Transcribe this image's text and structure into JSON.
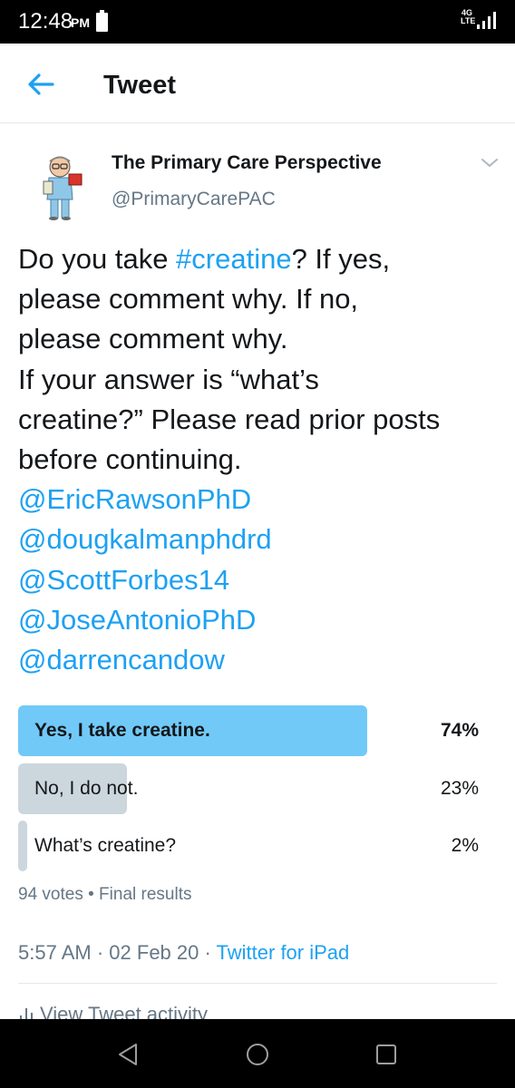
{
  "status_bar": {
    "time": "12:48",
    "ampm": "PM",
    "network_top": "4G",
    "network_bottom": "LTE"
  },
  "header": {
    "back_icon": "arrow-left-icon",
    "title": "Tweet"
  },
  "author": {
    "name": "The Primary Care Perspective",
    "handle": "@PrimaryCarePAC",
    "menu_icon": "chevron-down-icon"
  },
  "tweet": {
    "lines": [
      {
        "segments": [
          {
            "text": "Do you take ",
            "link": false
          },
          {
            "text": "#creatine",
            "link": true
          },
          {
            "text": "? If yes,",
            "link": false
          }
        ]
      },
      {
        "segments": [
          {
            "text": "please comment why.  If no,",
            "link": false
          }
        ]
      },
      {
        "segments": [
          {
            "text": "please comment why.",
            "link": false
          }
        ]
      },
      {
        "segments": [
          {
            "text": "If your answer is “what’s",
            "link": false
          }
        ]
      },
      {
        "segments": [
          {
            "text": "creatine?” Please read prior posts",
            "link": false
          }
        ]
      },
      {
        "segments": [
          {
            "text": "before continuing.",
            "link": false
          }
        ]
      },
      {
        "segments": [
          {
            "text": "@EricRawsonPhD",
            "link": true
          }
        ]
      },
      {
        "segments": [
          {
            "text": "@dougkalmanphdrd",
            "link": true
          }
        ]
      },
      {
        "segments": [
          {
            "text": "@ScottForbes14",
            "link": true
          }
        ]
      },
      {
        "segments": [
          {
            "text": "@JoseAntonioPhD",
            "link": true
          }
        ]
      },
      {
        "segments": [
          {
            "text": "@darrencandow",
            "link": true
          }
        ]
      }
    ]
  },
  "poll": {
    "options": [
      {
        "label": "Yes, I take creatine.",
        "percent_label": "74%",
        "fraction": 0.74,
        "winner": true
      },
      {
        "label": "No, I do not.",
        "percent_label": "23%",
        "fraction": 0.23,
        "winner": false
      },
      {
        "label": "What’s creatine?",
        "percent_label": "2%",
        "fraction": 0.02,
        "winner": false
      }
    ],
    "votes": "94 votes",
    "separator": "•",
    "status": "Final results"
  },
  "meta": {
    "time": "5:57 AM",
    "date": "02 Feb 20",
    "separator": "·",
    "source": "Twitter for iPad"
  },
  "activity": {
    "label": "View Tweet activity",
    "icon": "bar-chart-icon"
  },
  "colors": {
    "link": "#1da1f2",
    "poll_winner": "#71c9f8",
    "poll_other": "#ccd6dd",
    "secondary_text": "#657786"
  }
}
